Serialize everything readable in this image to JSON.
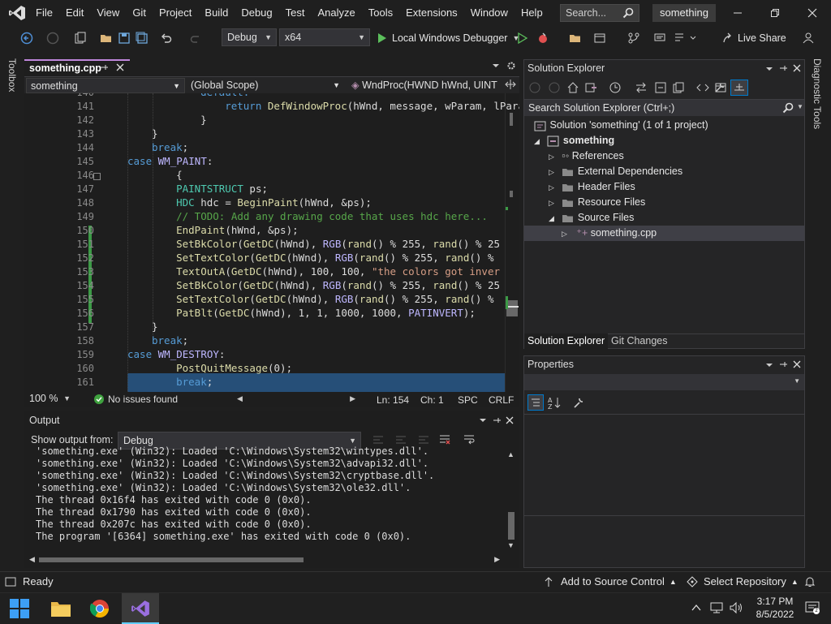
{
  "menu": [
    "File",
    "Edit",
    "View",
    "Git",
    "Project",
    "Build",
    "Debug",
    "Test",
    "Analyze",
    "Tools",
    "Extensions",
    "Window",
    "Help"
  ],
  "search": {
    "placeholder": "Search..."
  },
  "solution_name": "something",
  "toolbar": {
    "config": "Debug",
    "platform": "x64",
    "run_label": "Local Windows Debugger",
    "live_share": "Live Share"
  },
  "side": {
    "toolbox": "Toolbox",
    "diagnostic": "Diagnostic Tools"
  },
  "editor": {
    "tab_name": "something.cpp",
    "nav_project": "something",
    "nav_scope": "(Global Scope)",
    "nav_func": "WndProc(HWND hWnd, UINT",
    "zoom": "100 %",
    "issues": "No issues found",
    "line": "Ln: 154",
    "col": "Ch: 1",
    "spc": "SPC",
    "eol": "CRLF",
    "lines": [
      {
        "n": "140",
        "t": [
          [
            "    default:",
            "kw"
          ]
        ]
      },
      {
        "n": "141",
        "t": [
          [
            "        return ",
            "kw"
          ],
          [
            "DefWindowProc",
            "fn"
          ],
          [
            "(hWnd, message, wParam, lPara",
            ""
          ]
        ]
      },
      {
        "n": "142",
        "t": [
          [
            "    }",
            ""
          ]
        ]
      },
      {
        "n": "143",
        "t": [
          [
            "}",
            ""
          ]
        ]
      },
      {
        "n": "144",
        "t": [
          [
            "break",
            "kw"
          ],
          [
            ";",
            ""
          ]
        ]
      },
      {
        "n": "145",
        "t": [
          [
            "case ",
            "kw"
          ],
          [
            "WM_PAINT",
            "mac"
          ],
          [
            ":",
            ""
          ]
        ]
      },
      {
        "n": "146",
        "t": [
          [
            "    {",
            ""
          ]
        ]
      },
      {
        "n": "147",
        "t": [
          [
            "    PAINTSTRUCT ",
            "ty"
          ],
          [
            "ps",
            ""
          ],
          [
            ";",
            ""
          ]
        ]
      },
      {
        "n": "148",
        "t": [
          [
            "    HDC ",
            "ty"
          ],
          [
            "hdc = ",
            ""
          ],
          [
            "BeginPaint",
            "fn"
          ],
          [
            "(hWnd, &ps);",
            ""
          ]
        ]
      },
      {
        "n": "149",
        "t": [
          [
            "    // TODO: Add any drawing code that uses hdc here...",
            "cm"
          ]
        ]
      },
      {
        "n": "150",
        "t": [
          [
            "    ",
            ""
          ],
          [
            "EndPaint",
            "fn"
          ],
          [
            "(hWnd, &ps);",
            ""
          ]
        ]
      },
      {
        "n": "151",
        "t": [
          [
            "    ",
            ""
          ],
          [
            "SetBkColor",
            "fn"
          ],
          [
            "(",
            ""
          ],
          [
            "GetDC",
            "fn"
          ],
          [
            "(hWnd), ",
            ""
          ],
          [
            "RGB",
            "mac"
          ],
          [
            "(",
            ""
          ],
          [
            "rand",
            "fn"
          ],
          [
            "() % 255, ",
            ""
          ],
          [
            "rand",
            "fn"
          ],
          [
            "() % 25",
            ""
          ]
        ]
      },
      {
        "n": "152",
        "t": [
          [
            "    ",
            ""
          ],
          [
            "SetTextColor",
            "fn"
          ],
          [
            "(",
            ""
          ],
          [
            "GetDC",
            "fn"
          ],
          [
            "(hWnd), ",
            ""
          ],
          [
            "RGB",
            "mac"
          ],
          [
            "(",
            ""
          ],
          [
            "rand",
            "fn"
          ],
          [
            "() % 255, ",
            ""
          ],
          [
            "rand",
            "fn"
          ],
          [
            "() %",
            ""
          ]
        ]
      },
      {
        "n": "153",
        "t": [
          [
            "    ",
            ""
          ],
          [
            "TextOutA",
            "fn"
          ],
          [
            "(",
            ""
          ],
          [
            "GetDC",
            "fn"
          ],
          [
            "(hWnd), 100, 100, ",
            ""
          ],
          [
            "\"the colors got inver",
            "str"
          ]
        ]
      },
      {
        "n": "154",
        "t": [
          [
            "    ",
            ""
          ],
          [
            "SetBkColor",
            "fn"
          ],
          [
            "(",
            ""
          ],
          [
            "GetDC",
            "fn"
          ],
          [
            "(hWnd), ",
            ""
          ],
          [
            "RGB",
            "mac"
          ],
          [
            "(",
            ""
          ],
          [
            "rand",
            "fn"
          ],
          [
            "() % 255, ",
            ""
          ],
          [
            "rand",
            "fn"
          ],
          [
            "() % 25",
            ""
          ]
        ]
      },
      {
        "n": "155",
        "t": [
          [
            "    ",
            ""
          ],
          [
            "SetTextColor",
            "fn"
          ],
          [
            "(",
            ""
          ],
          [
            "GetDC",
            "fn"
          ],
          [
            "(hWnd), ",
            ""
          ],
          [
            "RGB",
            "mac"
          ],
          [
            "(",
            ""
          ],
          [
            "rand",
            "fn"
          ],
          [
            "() % 255, ",
            ""
          ],
          [
            "rand",
            "fn"
          ],
          [
            "() %",
            ""
          ]
        ]
      },
      {
        "n": "156",
        "t": [
          [
            "    ",
            ""
          ],
          [
            "PatBlt",
            "fn"
          ],
          [
            "(",
            ""
          ],
          [
            "GetDC",
            "fn"
          ],
          [
            "(hWnd), 1, 1, 1000, 1000, ",
            ""
          ],
          [
            "PATINVERT",
            "mac"
          ],
          [
            ");",
            ""
          ]
        ]
      },
      {
        "n": "157",
        "t": [
          [
            "}",
            ""
          ]
        ]
      },
      {
        "n": "158",
        "t": [
          [
            "break",
            "kw"
          ],
          [
            ";",
            ""
          ]
        ]
      },
      {
        "n": "159",
        "t": [
          [
            "case ",
            "kw"
          ],
          [
            "WM_DESTROY",
            "mac"
          ],
          [
            ":",
            ""
          ]
        ]
      },
      {
        "n": "160",
        "t": [
          [
            "    ",
            ""
          ],
          [
            "PostQuitMessage",
            "fn"
          ],
          [
            "(0);",
            ""
          ]
        ]
      },
      {
        "n": "161",
        "t": [
          [
            "    break",
            "kw"
          ],
          [
            ";",
            ""
          ]
        ]
      }
    ]
  },
  "output": {
    "title": "Output",
    "show_from_label": "Show output from:",
    "source": "Debug",
    "lines": [
      "'something.exe' (Win32): Loaded 'C:\\Windows\\System32\\wintypes.dll'.",
      "'something.exe' (Win32): Loaded 'C:\\Windows\\System32\\advapi32.dll'.",
      "'something.exe' (Win32): Loaded 'C:\\Windows\\System32\\cryptbase.dll'.",
      "'something.exe' (Win32): Loaded 'C:\\Windows\\System32\\ole32.dll'.",
      "The thread 0x16f4 has exited with code 0 (0x0).",
      "The thread 0x1790 has exited with code 0 (0x0).",
      "The thread 0x207c has exited with code 0 (0x0).",
      "The program '[6364] something.exe' has exited with code 0 (0x0)."
    ]
  },
  "solution_explorer": {
    "title": "Solution Explorer",
    "search_placeholder": "Search Solution Explorer (Ctrl+;)",
    "solution": "Solution 'something' (1 of 1 project)",
    "project": "something",
    "items": [
      "References",
      "External Dependencies",
      "Header Files",
      "Resource Files",
      "Source Files"
    ],
    "file": "something.cpp",
    "tab_active": "Solution Explorer",
    "tab_other": "Git Changes"
  },
  "properties": {
    "title": "Properties"
  },
  "status": {
    "ready": "Ready",
    "source_control": "Add to Source Control",
    "repo": "Select Repository"
  },
  "clock": {
    "time": "3:17 PM",
    "date": "8/5/2022"
  },
  "colors": {
    "accent": "#c087dc",
    "selection": "#264f78",
    "vs_purple": "#7b5fc7"
  }
}
